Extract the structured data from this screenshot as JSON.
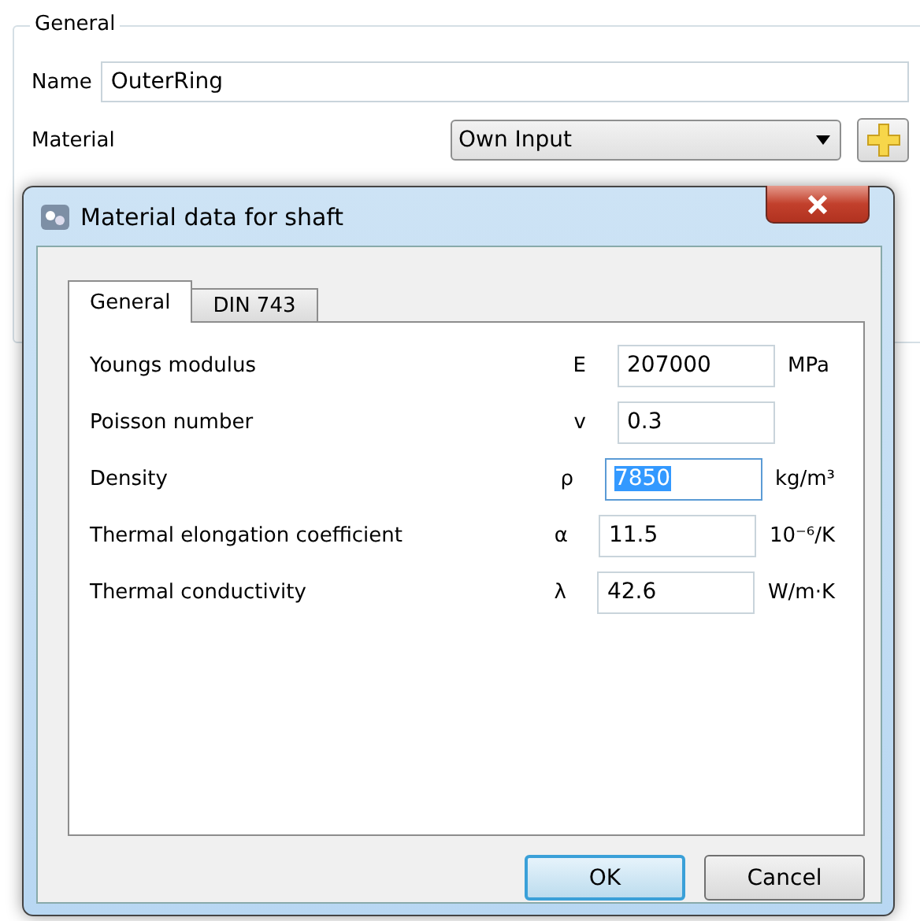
{
  "group": {
    "legend": "General",
    "name_label": "Name",
    "name_value": "OuterRing",
    "material_label": "Material",
    "material_value": "Own Input"
  },
  "dialog": {
    "title": "Material data for shaft",
    "tabs": [
      {
        "label": "General",
        "selected": true
      },
      {
        "label": "DIN 743",
        "selected": false
      }
    ],
    "properties": [
      {
        "label": "Youngs modulus",
        "symbol": "E",
        "value": "207000",
        "unit": "MPa",
        "text_selected": false
      },
      {
        "label": "Poisson number",
        "symbol": "v",
        "value": "0.3",
        "text_selected": false
      },
      {
        "label": "Density",
        "symbol": "ρ",
        "value": "7850",
        "unit": "kg/m³",
        "text_selected": true
      },
      {
        "label": "Thermal elongation coefficient",
        "symbol": "α",
        "value": "11.5",
        "unit": "10⁻⁶/K",
        "text_selected": false
      },
      {
        "label": "Thermal conductivity",
        "symbol": "λ",
        "value": "42.6",
        "unit": "W/m·K",
        "text_selected": false
      }
    ],
    "buttons": [
      {
        "label": "OK",
        "default": true
      },
      {
        "label": "Cancel",
        "default": false
      }
    ]
  }
}
